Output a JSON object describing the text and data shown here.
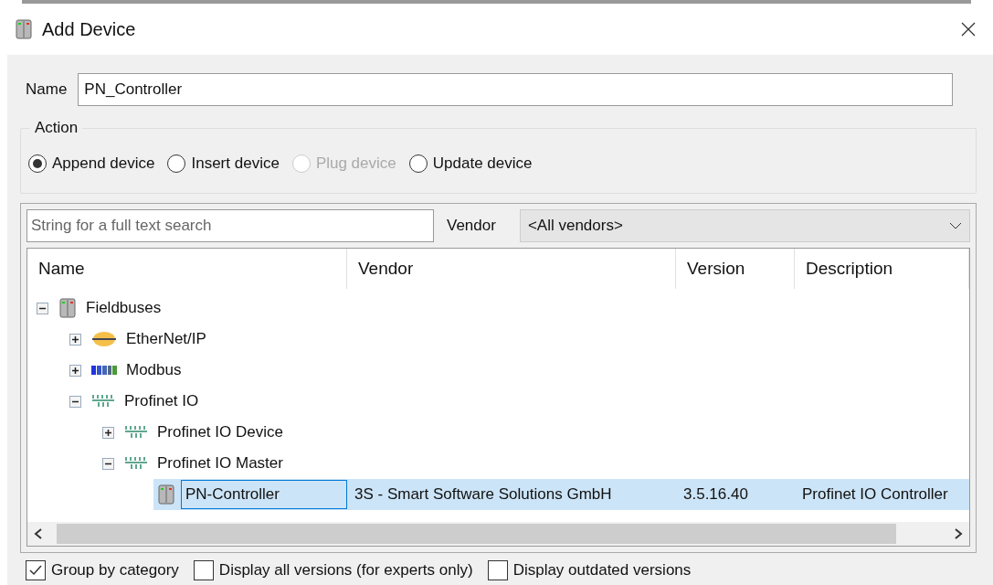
{
  "window": {
    "title": "Add Device"
  },
  "name_field": {
    "label": "Name",
    "value": "PN_Controller"
  },
  "action": {
    "title": "Action",
    "options": [
      {
        "label": "Append device",
        "selected": true,
        "disabled": false
      },
      {
        "label": "Insert device",
        "selected": false,
        "disabled": false
      },
      {
        "label": "Plug device",
        "selected": false,
        "disabled": true
      },
      {
        "label": "Update device",
        "selected": false,
        "disabled": false
      }
    ]
  },
  "search": {
    "placeholder": "String for a full text search"
  },
  "vendor_filter": {
    "label": "Vendor",
    "value": "<All vendors>"
  },
  "table": {
    "columns": [
      "Name",
      "Vendor",
      "Version",
      "Description"
    ],
    "rows": [
      {
        "kind": "device",
        "name": "Fieldbuses",
        "expanded": true,
        "selected": false,
        "children": [
          {
            "kind": "ethernet",
            "name": "EtherNet/IP",
            "expanded": false,
            "selected": false
          },
          {
            "kind": "modbus",
            "name": "Modbus",
            "expanded": false,
            "selected": false
          },
          {
            "kind": "profinet",
            "name": "Profinet IO",
            "expanded": true,
            "selected": false,
            "children": [
              {
                "kind": "profinet",
                "name": "Profinet IO Device",
                "expanded": false,
                "selected": false
              },
              {
                "kind": "profinet",
                "name": "Profinet IO Master",
                "expanded": true,
                "selected": false,
                "children": [
                  {
                    "kind": "device",
                    "name": "PN-Controller",
                    "vendor": "3S - Smart Software Solutions GmbH",
                    "version": "3.5.16.40",
                    "description": "Profinet IO Controller",
                    "selected": true
                  }
                ]
              }
            ]
          }
        ]
      }
    ]
  },
  "options": [
    {
      "label": "Group by category",
      "checked": true
    },
    {
      "label": "Display all versions (for experts only)",
      "checked": false
    },
    {
      "label": "Display outdated versions",
      "checked": false
    }
  ]
}
